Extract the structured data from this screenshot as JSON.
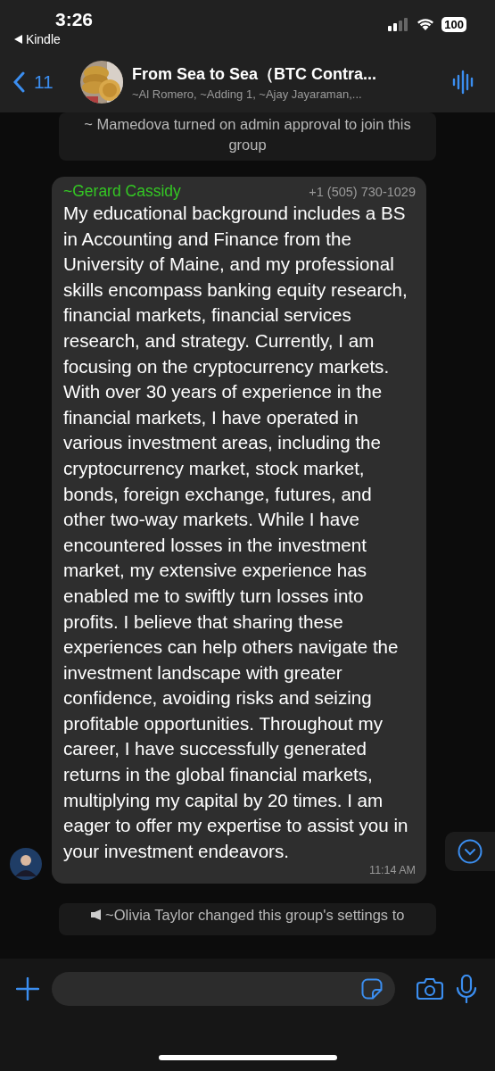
{
  "status_bar": {
    "time": "3:26",
    "back_app": "Kindle",
    "battery": "100"
  },
  "header": {
    "back_count": "11",
    "title": "From Sea to Sea（BTC Contra...",
    "subtitle": "~Al Romero, ~Adding 1, ~Ajay Jayaraman,..."
  },
  "system_top": {
    "text": "~ Mamedova turned on admin approval to join this group"
  },
  "message": {
    "sender": "~Gerard Cassidy",
    "phone": "+1 (505) 730-1029",
    "text": "My educational background includes a BS in Accounting and Finance from the University of Maine, and my professional skills encompass banking equity research, financial markets, financial services research, and strategy. Currently, I am focusing on the cryptocurrency markets. With over 30 years of experience in the financial markets, I have operated in various investment areas, including the cryptocurrency market, stock market, bonds, foreign exchange, futures, and other two-way markets. While I have encountered losses in the investment market, my extensive experience has enabled me to swiftly turn losses into profits. I believe that sharing these experiences can help others navigate the investment landscape with greater confidence, avoiding risks and seizing profitable opportunities. Throughout my career, I have successfully generated returns in the global financial markets, multiplying my capital by 20 times. I am eager to offer my expertise to assist you in your investment endeavors.",
    "time": "11:14 AM"
  },
  "system_bottom": {
    "text": "~Olivia Taylor changed this group's settings to"
  }
}
